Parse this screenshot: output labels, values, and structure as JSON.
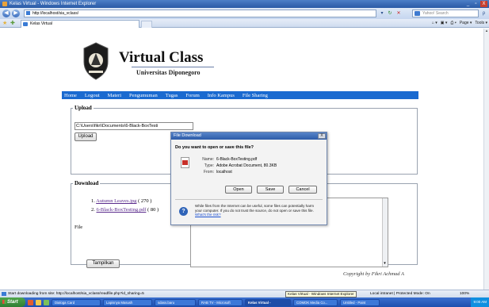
{
  "window": {
    "title": "Kelas Virtual - Windows Internet Explorer",
    "controls": [
      "_",
      "▫",
      "X"
    ]
  },
  "address_bar": {
    "back_glyph": "◀",
    "forward_glyph": "▶",
    "url": "http://localhost/sia_vclass/",
    "search_placeholder": "Yahoo! Search",
    "search_go": "ρ"
  },
  "tabs": {
    "active_label": "Kelas Virtual",
    "command_bar": [
      "Page ▾",
      "Tools ▾"
    ]
  },
  "site": {
    "title": "Virtual Class",
    "subtitle": "Universitas Diponegoro",
    "menu": [
      "Home",
      "Logout",
      "Materi",
      "Pengumuman",
      "Tugas",
      "Forum",
      "Info Kampus",
      "File Sharing"
    ]
  },
  "upload": {
    "legend": "Upload",
    "file_value": "C:\\Users\\fikri\\Documents\\6-Black-BoxTesti",
    "button_label": "Upload"
  },
  "download": {
    "legend": "Download",
    "items": [
      {
        "num": "1.",
        "name": "Autumn Leaves.jpg",
        "size": "( 270 )"
      },
      {
        "num": "2.",
        "name": "6-Black-BoxTesting.pdf",
        "size": "( 80 )"
      }
    ],
    "file_label": "File",
    "tampilkan_label": "Tampilkan"
  },
  "copyright": "Copyright by Fikri Achmad A",
  "dialog": {
    "title": "File Download",
    "close": "X",
    "question": "Do you want to open or save this file?",
    "name_key": "Name:",
    "name_val": "6-Black-BoxTesting.pdf",
    "type_key": "Type:",
    "type_val": "Adobe Acrobat Document, 80.3KB",
    "from_key": "From:",
    "from_val": "localhost",
    "open_label": "Open",
    "save_label": "Save",
    "cancel_label": "Cancel",
    "warning": "While files from the Internet can be useful, some files can potentially harm your computer. If you do not trust the source, do not open or save this file.",
    "risk_link": "What's the risk?"
  },
  "status": {
    "text": "Start downloading from site: http://localhost/sia_vclass/readfile.php?id_sharing=5",
    "tooltip": "Kelas Virtual - Windows Internet Explorer",
    "zone": "Local intranet | Protected Mode: On",
    "zoom": "100%"
  },
  "taskbar": {
    "start": "Start",
    "tasks": [
      "Dialoga Card",
      "Lapisnya Masush",
      "sdass.baru",
      "RAB TV - Microsoft",
      "Kelas Virtual -",
      "COMOK Media Co...",
      "Untitled - Paint"
    ],
    "clock": "9:00 AM"
  },
  "colors": {
    "menubar": "#1a6ad0",
    "link_visited": "#5a2b8c",
    "titlebar": "#2a5aa6"
  }
}
